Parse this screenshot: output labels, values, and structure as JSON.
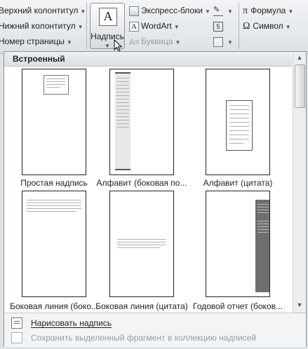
{
  "ribbon": {
    "header_footer": {
      "header": "Верхний колонтитул",
      "footer": "Нижний колонтитул",
      "page_number": "Номер страницы"
    },
    "textbox_button": {
      "label": "Надпись"
    },
    "text_group": {
      "quick_parts": "Экспресс-блоки",
      "wordart": "WordArt",
      "dropcap": "Буквица"
    },
    "symbols": {
      "equation": "Формула",
      "symbol": "Символ"
    }
  },
  "gallery": {
    "section_title": "Встроенный",
    "items": [
      {
        "label": "Простая надпись"
      },
      {
        "label": "Алфавит (боковая по..."
      },
      {
        "label": "Алфавит (цитата)"
      },
      {
        "label": "Боковая линия (боко..."
      },
      {
        "label": "Боковая линия (цитата)"
      },
      {
        "label": "Годовой отчет (боков..."
      }
    ]
  },
  "footer": {
    "draw_textbox": "Нарисовать надпись",
    "save_selection": "Сохранить выделенный фрагмент в коллекцию надписей"
  },
  "colors": {
    "panel_bg": "#ffffff",
    "ribbon_bg": "#e4e7eb",
    "dark_sidebar": "#6e6e6e"
  }
}
